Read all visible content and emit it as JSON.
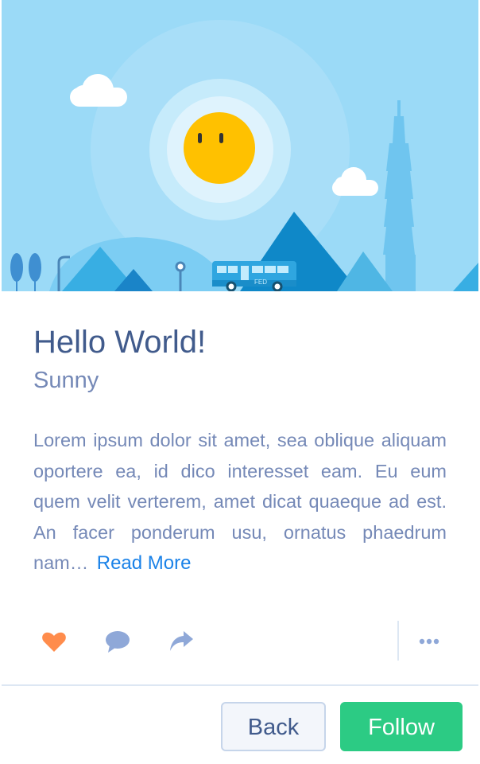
{
  "card": {
    "title": "Hello World!",
    "subtitle": "Sunny",
    "body": "Lorem ipsum dolor sit amet, sea oblique aliquam oportere ea, id dico interesset eam. Eu eum quem velit verterem, amet dicat quaeque ad est. An facer ponderum usu, ornatus phaedrum nam…",
    "read_more": "Read More"
  },
  "illustration": {
    "bus_label": "FED",
    "icons": [
      "cloud-icon",
      "sun-icon",
      "mountain-icon",
      "tower-icon",
      "bus-icon",
      "tree-icon",
      "street-lamp-icon"
    ]
  },
  "actions": {
    "icons": [
      "heart-icon",
      "comment-icon",
      "share-icon",
      "more-icon"
    ]
  },
  "buttons": {
    "back": "Back",
    "follow": "Follow"
  },
  "colors": {
    "sky": "#9bdaf7",
    "sun": "#ffc100",
    "title": "#415b8c",
    "text": "#7589b7",
    "link": "#1a82e8",
    "heart": "#ff8c4c",
    "follow": "#2ccb84"
  }
}
